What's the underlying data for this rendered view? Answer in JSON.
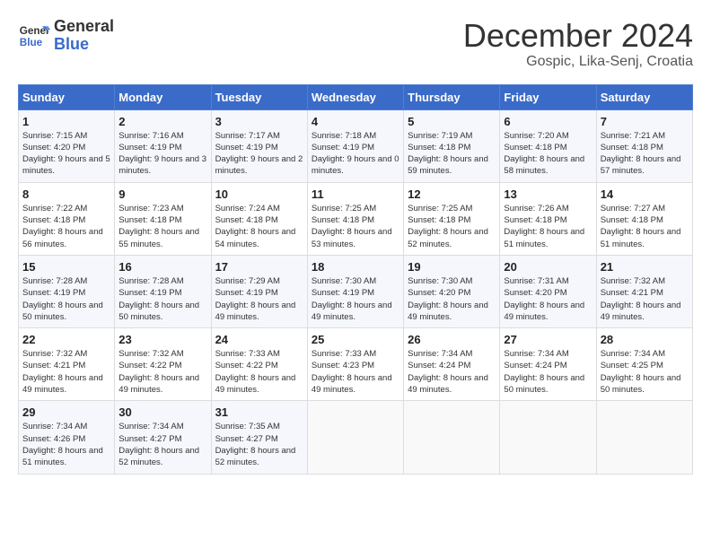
{
  "logo": {
    "line1": "General",
    "line2": "Blue"
  },
  "title": "December 2024",
  "subtitle": "Gospic, Lika-Senj, Croatia",
  "days_header": [
    "Sunday",
    "Monday",
    "Tuesday",
    "Wednesday",
    "Thursday",
    "Friday",
    "Saturday"
  ],
  "weeks": [
    [
      {
        "day": "1",
        "text": "Sunrise: 7:15 AM\nSunset: 4:20 PM\nDaylight: 9 hours and 5 minutes."
      },
      {
        "day": "2",
        "text": "Sunrise: 7:16 AM\nSunset: 4:19 PM\nDaylight: 9 hours and 3 minutes."
      },
      {
        "day": "3",
        "text": "Sunrise: 7:17 AM\nSunset: 4:19 PM\nDaylight: 9 hours and 2 minutes."
      },
      {
        "day": "4",
        "text": "Sunrise: 7:18 AM\nSunset: 4:19 PM\nDaylight: 9 hours and 0 minutes."
      },
      {
        "day": "5",
        "text": "Sunrise: 7:19 AM\nSunset: 4:18 PM\nDaylight: 8 hours and 59 minutes."
      },
      {
        "day": "6",
        "text": "Sunrise: 7:20 AM\nSunset: 4:18 PM\nDaylight: 8 hours and 58 minutes."
      },
      {
        "day": "7",
        "text": "Sunrise: 7:21 AM\nSunset: 4:18 PM\nDaylight: 8 hours and 57 minutes."
      }
    ],
    [
      {
        "day": "8",
        "text": "Sunrise: 7:22 AM\nSunset: 4:18 PM\nDaylight: 8 hours and 56 minutes."
      },
      {
        "day": "9",
        "text": "Sunrise: 7:23 AM\nSunset: 4:18 PM\nDaylight: 8 hours and 55 minutes."
      },
      {
        "day": "10",
        "text": "Sunrise: 7:24 AM\nSunset: 4:18 PM\nDaylight: 8 hours and 54 minutes."
      },
      {
        "day": "11",
        "text": "Sunrise: 7:25 AM\nSunset: 4:18 PM\nDaylight: 8 hours and 53 minutes."
      },
      {
        "day": "12",
        "text": "Sunrise: 7:25 AM\nSunset: 4:18 PM\nDaylight: 8 hours and 52 minutes."
      },
      {
        "day": "13",
        "text": "Sunrise: 7:26 AM\nSunset: 4:18 PM\nDaylight: 8 hours and 51 minutes."
      },
      {
        "day": "14",
        "text": "Sunrise: 7:27 AM\nSunset: 4:18 PM\nDaylight: 8 hours and 51 minutes."
      }
    ],
    [
      {
        "day": "15",
        "text": "Sunrise: 7:28 AM\nSunset: 4:19 PM\nDaylight: 8 hours and 50 minutes."
      },
      {
        "day": "16",
        "text": "Sunrise: 7:28 AM\nSunset: 4:19 PM\nDaylight: 8 hours and 50 minutes."
      },
      {
        "day": "17",
        "text": "Sunrise: 7:29 AM\nSunset: 4:19 PM\nDaylight: 8 hours and 49 minutes."
      },
      {
        "day": "18",
        "text": "Sunrise: 7:30 AM\nSunset: 4:19 PM\nDaylight: 8 hours and 49 minutes."
      },
      {
        "day": "19",
        "text": "Sunrise: 7:30 AM\nSunset: 4:20 PM\nDaylight: 8 hours and 49 minutes."
      },
      {
        "day": "20",
        "text": "Sunrise: 7:31 AM\nSunset: 4:20 PM\nDaylight: 8 hours and 49 minutes."
      },
      {
        "day": "21",
        "text": "Sunrise: 7:32 AM\nSunset: 4:21 PM\nDaylight: 8 hours and 49 minutes."
      }
    ],
    [
      {
        "day": "22",
        "text": "Sunrise: 7:32 AM\nSunset: 4:21 PM\nDaylight: 8 hours and 49 minutes."
      },
      {
        "day": "23",
        "text": "Sunrise: 7:32 AM\nSunset: 4:22 PM\nDaylight: 8 hours and 49 minutes."
      },
      {
        "day": "24",
        "text": "Sunrise: 7:33 AM\nSunset: 4:22 PM\nDaylight: 8 hours and 49 minutes."
      },
      {
        "day": "25",
        "text": "Sunrise: 7:33 AM\nSunset: 4:23 PM\nDaylight: 8 hours and 49 minutes."
      },
      {
        "day": "26",
        "text": "Sunrise: 7:34 AM\nSunset: 4:24 PM\nDaylight: 8 hours and 49 minutes."
      },
      {
        "day": "27",
        "text": "Sunrise: 7:34 AM\nSunset: 4:24 PM\nDaylight: 8 hours and 50 minutes."
      },
      {
        "day": "28",
        "text": "Sunrise: 7:34 AM\nSunset: 4:25 PM\nDaylight: 8 hours and 50 minutes."
      }
    ],
    [
      {
        "day": "29",
        "text": "Sunrise: 7:34 AM\nSunset: 4:26 PM\nDaylight: 8 hours and 51 minutes."
      },
      {
        "day": "30",
        "text": "Sunrise: 7:34 AM\nSunset: 4:27 PM\nDaylight: 8 hours and 52 minutes."
      },
      {
        "day": "31",
        "text": "Sunrise: 7:35 AM\nSunset: 4:27 PM\nDaylight: 8 hours and 52 minutes."
      },
      {
        "day": "",
        "text": ""
      },
      {
        "day": "",
        "text": ""
      },
      {
        "day": "",
        "text": ""
      },
      {
        "day": "",
        "text": ""
      }
    ]
  ]
}
